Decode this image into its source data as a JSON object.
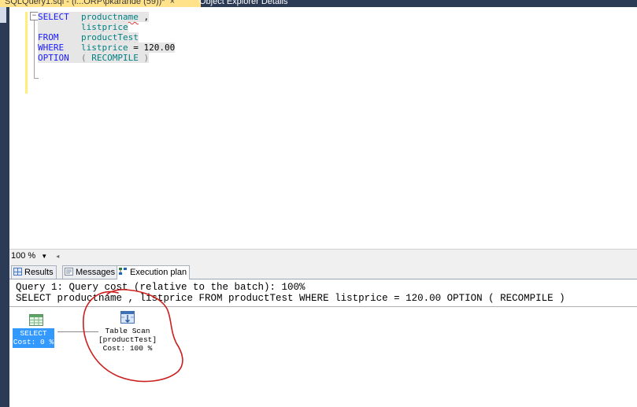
{
  "tabs": {
    "active_title": "SQLQuery1.sql - (l...ORP\\pkarande (59))*",
    "close_symbol": "×",
    "inactive_title": "Object Explorer Details"
  },
  "editor": {
    "fold_symbol": "−",
    "lines": [
      {
        "kw": "SELECT",
        "parts": [
          {
            "cls": "id",
            "text": "productname"
          },
          {
            "cls": "txt",
            "text": " ,"
          }
        ]
      },
      {
        "kw": "",
        "parts": [
          {
            "cls": "id",
            "text": "listprice"
          }
        ]
      },
      {
        "kw": "FROM",
        "parts": [
          {
            "cls": "id",
            "text": "productTest"
          }
        ]
      },
      {
        "kw": "WHERE",
        "parts": [
          {
            "cls": "id",
            "text": "listprice"
          },
          {
            "cls": "txt",
            "text": " = "
          },
          {
            "cls": "num",
            "text": "120.00"
          }
        ]
      },
      {
        "kw": "OPTION",
        "parts": [
          {
            "cls": "gray",
            "text": "( "
          },
          {
            "cls": "tealplain",
            "text": "RECOMPILE"
          },
          {
            "cls": "gray",
            "text": " )"
          }
        ]
      }
    ]
  },
  "zoom": {
    "value": "100 %",
    "dropdown": "▼",
    "scroll_left": "◂"
  },
  "result_tabs": {
    "results": "Results",
    "messages": "Messages",
    "execution_plan": "Execution plan"
  },
  "plan": {
    "line1": "Query 1: Query cost (relative to the batch): 100%",
    "line2": "SELECT productname , listprice FROM productTest WHERE listprice = 120.00 OPTION ( RECOMPILE )",
    "select_op": {
      "name": "SELECT",
      "cost": "Cost: 0 %"
    },
    "scan_op": {
      "name": "Table Scan",
      "table": "[productTest]",
      "cost": "Cost: 100 %"
    }
  },
  "colors": {
    "active_tab": "#ffe28a",
    "chrome": "#2b3a55",
    "selected_op": "#3399ff",
    "annotation": "#cc1f1f"
  }
}
